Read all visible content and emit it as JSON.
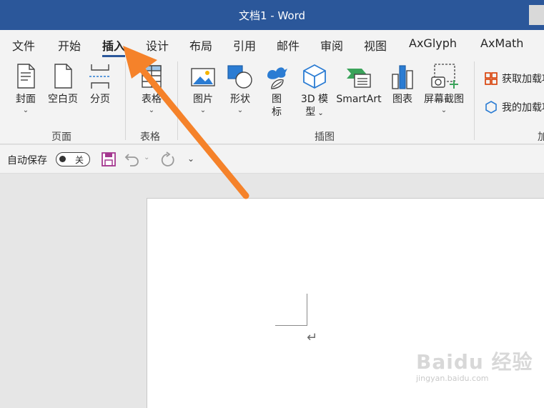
{
  "titlebar": {
    "title": "文档1  -  Word"
  },
  "tabs": [
    "文件",
    "开始",
    "插入",
    "设计",
    "布局",
    "引用",
    "邮件",
    "审阅",
    "视图",
    "AxGlyph",
    "AxMath"
  ],
  "active_tab": "插入",
  "ribbon": {
    "groups": {
      "pages": "页面",
      "tables": "表格",
      "illustrations": "插图",
      "addins_partial": "加"
    },
    "buttons": {
      "cover": "封面",
      "blank_page": "空白页",
      "page_break": "分页",
      "table": "表格",
      "pictures": "图片",
      "shapes": "形状",
      "icons_line1": "图",
      "icons_line2": "标",
      "model_line1": "3D 模",
      "model_line2": "型",
      "smartart": "SmartArt",
      "chart": "图表",
      "screenshot": "屏幕截图"
    },
    "addins": {
      "get_addins": "获取加载项",
      "my_addins": "我的加载项"
    }
  },
  "qat": {
    "autosave_label": "自动保存",
    "autosave_state": "关"
  },
  "watermark": {
    "logo": "Baidu 经验",
    "url": "jingyan.baidu.com"
  },
  "colors": {
    "titlebar": "#2b579a",
    "annotation_arrow": "#f5822a",
    "ribbon_bg": "#f3f3f3",
    "accent_blue": "#2b7cd3"
  }
}
